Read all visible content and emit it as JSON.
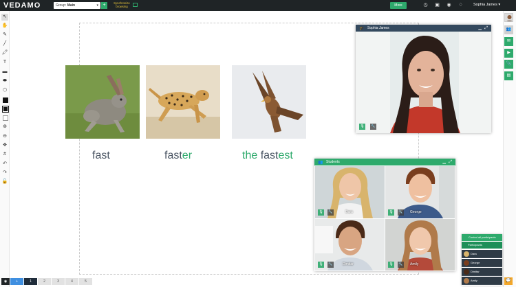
{
  "topbar": {
    "logo": "VEDAMO",
    "group_label": "Group:",
    "group_value": "Main",
    "sync_label": "Synchronize browsing",
    "more_label": "More",
    "user_name": "Sophia James"
  },
  "slide": {
    "words": [
      {
        "base": "fast",
        "highlight": "",
        "prefix": ""
      },
      {
        "base": "fast",
        "highlight": "er",
        "prefix": ""
      },
      {
        "base": "fast",
        "highlight": "est",
        "prefix": "the "
      }
    ]
  },
  "teacher_video": {
    "title": "Sophia James"
  },
  "students_video": {
    "title": "Students",
    "tiles": [
      {
        "name": "Dara"
      },
      {
        "name": "George"
      },
      {
        "name": "Dimitar"
      },
      {
        "name": "Amily"
      }
    ]
  },
  "participants_panel": {
    "control_label": "Control all participants",
    "header_label": "Participants",
    "items": [
      {
        "name": "Dara"
      },
      {
        "name": "George"
      },
      {
        "name": "Dimitar"
      },
      {
        "name": "Amily"
      }
    ]
  },
  "pages": {
    "items": [
      "1",
      "2",
      "3",
      "4",
      "5"
    ],
    "current": "1"
  },
  "colors": {
    "accent": "#2eaa6c",
    "topbar": "#1f2426",
    "word_text": "#4a5563",
    "highlight": "#2eaa6c"
  }
}
